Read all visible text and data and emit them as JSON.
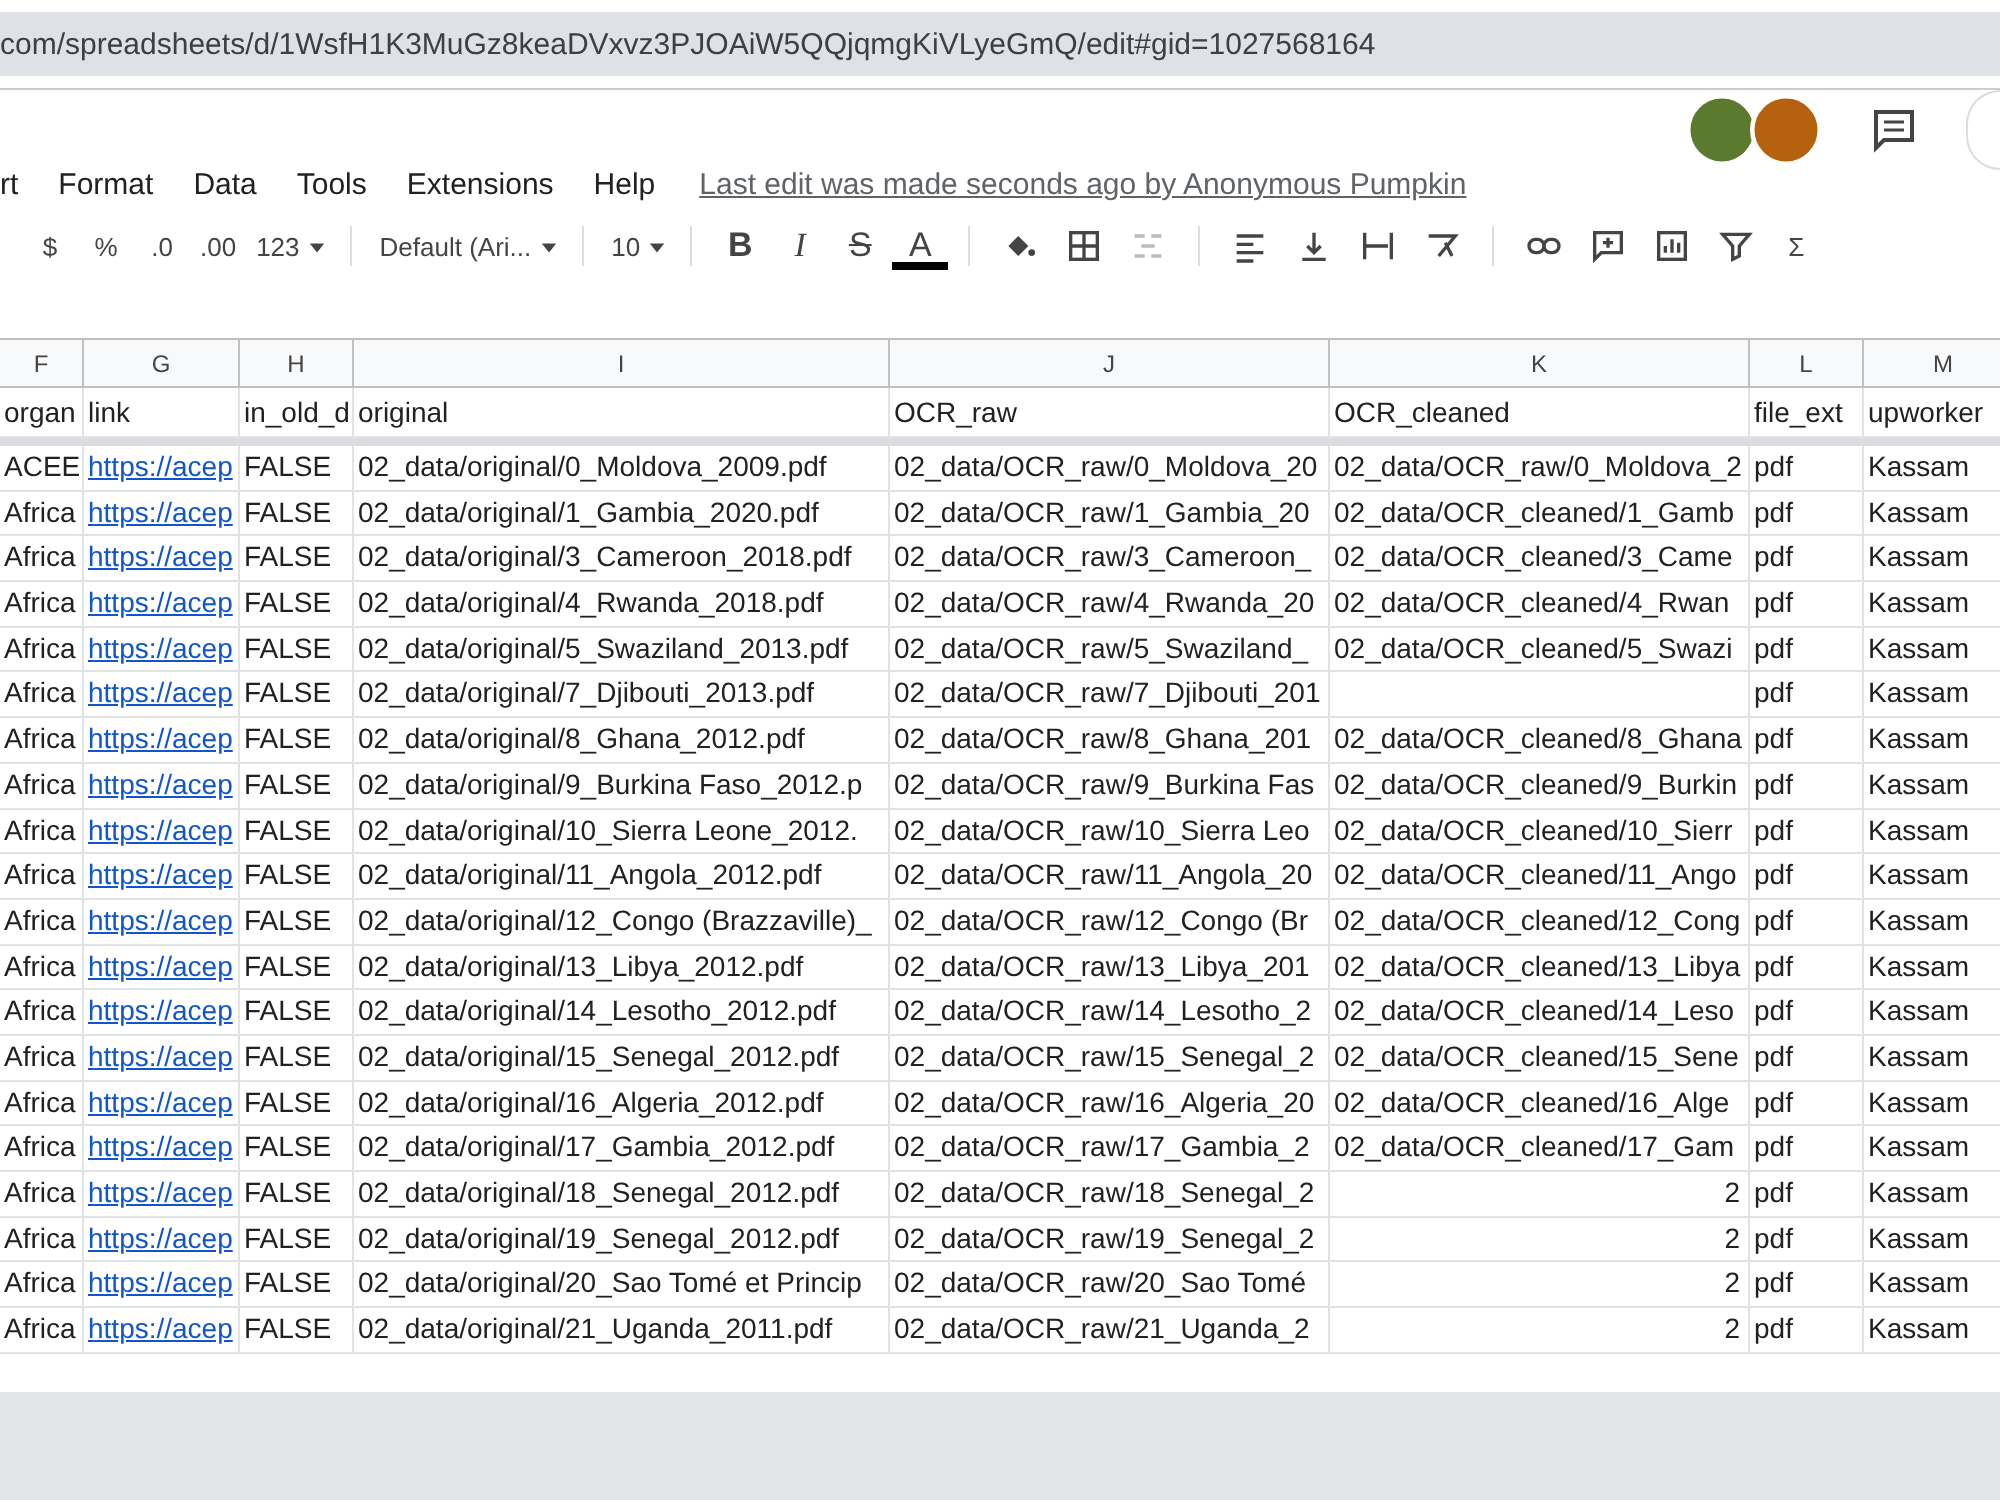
{
  "address_bar": {
    "url": "com/spreadsheets/d/1WsfH1K3MuGz8keaDVxvz3PJOAiW5QQjqmgKiVLyeGmQ/edit#gid=1027568164"
  },
  "menu": [
    "rt",
    "Format",
    "Data",
    "Tools",
    "Extensions",
    "Help"
  ],
  "last_edit": "Last edit was made seconds ago by Anonymous Pumpkin",
  "collaborators": [
    {
      "color": "#5b7a2e"
    },
    {
      "color": "#b5620f"
    }
  ],
  "toolbar": [
    {
      "kind": "text",
      "label": "$"
    },
    {
      "kind": "text",
      "label": "%"
    },
    {
      "kind": "text",
      "label": ".0"
    },
    {
      "kind": "text",
      "label": ".00"
    },
    {
      "kind": "dropdown",
      "label": "123"
    },
    {
      "kind": "sep"
    },
    {
      "kind": "dropdown",
      "label": "Default (Ari..."
    },
    {
      "kind": "sep"
    },
    {
      "kind": "dropdown",
      "label": "10"
    },
    {
      "kind": "sep"
    },
    {
      "kind": "bold",
      "label": "B"
    },
    {
      "kind": "italic",
      "label": "I"
    },
    {
      "kind": "strike",
      "label": "S"
    },
    {
      "kind": "color",
      "label": "A"
    },
    {
      "kind": "sep"
    },
    {
      "kind": "fill"
    },
    {
      "kind": "borders"
    },
    {
      "kind": "merge"
    },
    {
      "kind": "sep"
    },
    {
      "kind": "halign"
    },
    {
      "kind": "valign"
    },
    {
      "kind": "wrap"
    },
    {
      "kind": "rotate"
    },
    {
      "kind": "sep"
    },
    {
      "kind": "link"
    },
    {
      "kind": "comment"
    },
    {
      "kind": "chart"
    },
    {
      "kind": "filter"
    },
    {
      "kind": "text",
      "label": "Σ"
    }
  ],
  "columns": [
    {
      "letter": "F",
      "header": "organ"
    },
    {
      "letter": "G",
      "header": "link"
    },
    {
      "letter": "H",
      "header": "in_old_d"
    },
    {
      "letter": "I",
      "header": "original"
    },
    {
      "letter": "J",
      "header": "OCR_raw"
    },
    {
      "letter": "K",
      "header": "OCR_cleaned"
    },
    {
      "letter": "L",
      "header": "file_ext"
    },
    {
      "letter": "M",
      "header": "upworker"
    }
  ],
  "rows": [
    {
      "cells": [
        {
          "kind": "text",
          "text": "ACEE"
        },
        {
          "kind": "link",
          "text": "https://acep"
        },
        {
          "kind": "text",
          "text": "FALSE"
        },
        {
          "kind": "text",
          "text": "02_data/original/0_Moldova_2009.pdf"
        },
        {
          "kind": "text",
          "text": "02_data/OCR_raw/0_Moldova_20"
        },
        {
          "kind": "text",
          "text": "02_data/OCR_raw/0_Moldova_2"
        },
        {
          "kind": "text",
          "text": "pdf"
        },
        {
          "kind": "text",
          "text": "Kassam"
        }
      ]
    },
    {
      "cells": [
        {
          "kind": "text",
          "text": "Africa"
        },
        {
          "kind": "link",
          "text": "https://acep"
        },
        {
          "kind": "text",
          "text": "FALSE"
        },
        {
          "kind": "text",
          "text": "02_data/original/1_Gambia_2020.pdf"
        },
        {
          "kind": "text",
          "text": "02_data/OCR_raw/1_Gambia_20"
        },
        {
          "kind": "text",
          "text": "02_data/OCR_cleaned/1_Gamb"
        },
        {
          "kind": "text",
          "text": "pdf"
        },
        {
          "kind": "text",
          "text": "Kassam"
        }
      ]
    },
    {
      "cells": [
        {
          "kind": "text",
          "text": "Africa"
        },
        {
          "kind": "link",
          "text": "https://acep"
        },
        {
          "kind": "text",
          "text": "FALSE"
        },
        {
          "kind": "text",
          "text": "02_data/original/3_Cameroon_2018.pdf"
        },
        {
          "kind": "text",
          "text": "02_data/OCR_raw/3_Cameroon_"
        },
        {
          "kind": "text",
          "text": "02_data/OCR_cleaned/3_Came"
        },
        {
          "kind": "text",
          "text": "pdf"
        },
        {
          "kind": "text",
          "text": "Kassam"
        }
      ]
    },
    {
      "cells": [
        {
          "kind": "text",
          "text": "Africa"
        },
        {
          "kind": "link",
          "text": "https://acep"
        },
        {
          "kind": "text",
          "text": "FALSE"
        },
        {
          "kind": "text",
          "text": "02_data/original/4_Rwanda_2018.pdf"
        },
        {
          "kind": "text",
          "text": "02_data/OCR_raw/4_Rwanda_20"
        },
        {
          "kind": "text",
          "text": "02_data/OCR_cleaned/4_Rwan"
        },
        {
          "kind": "text",
          "text": "pdf"
        },
        {
          "kind": "text",
          "text": "Kassam"
        }
      ]
    },
    {
      "cells": [
        {
          "kind": "text",
          "text": "Africa"
        },
        {
          "kind": "link",
          "text": "https://acep"
        },
        {
          "kind": "text",
          "text": "FALSE"
        },
        {
          "kind": "text",
          "text": "02_data/original/5_Swaziland_2013.pdf"
        },
        {
          "kind": "text",
          "text": "02_data/OCR_raw/5_Swaziland_"
        },
        {
          "kind": "text",
          "text": "02_data/OCR_cleaned/5_Swazi"
        },
        {
          "kind": "text",
          "text": "pdf"
        },
        {
          "kind": "text",
          "text": "Kassam"
        }
      ]
    },
    {
      "cells": [
        {
          "kind": "text",
          "text": "Africa"
        },
        {
          "kind": "link",
          "text": "https://acep"
        },
        {
          "kind": "text",
          "text": "FALSE"
        },
        {
          "kind": "text",
          "text": "02_data/original/7_Djibouti_2013.pdf"
        },
        {
          "kind": "text",
          "text": "02_data/OCR_raw/7_Djibouti_201"
        },
        {
          "kind": "blank"
        },
        {
          "kind": "text",
          "text": "pdf"
        },
        {
          "kind": "text",
          "text": "Kassam"
        }
      ]
    },
    {
      "cells": [
        {
          "kind": "text",
          "text": "Africa"
        },
        {
          "kind": "link",
          "text": "https://acep"
        },
        {
          "kind": "text",
          "text": "FALSE"
        },
        {
          "kind": "text",
          "text": "02_data/original/8_Ghana_2012.pdf"
        },
        {
          "kind": "text",
          "text": "02_data/OCR_raw/8_Ghana_201"
        },
        {
          "kind": "text",
          "text": "02_data/OCR_cleaned/8_Ghana"
        },
        {
          "kind": "text",
          "text": "pdf"
        },
        {
          "kind": "text",
          "text": "Kassam"
        }
      ]
    },
    {
      "cells": [
        {
          "kind": "text",
          "text": "Africa"
        },
        {
          "kind": "link",
          "text": "https://acep"
        },
        {
          "kind": "text",
          "text": "FALSE"
        },
        {
          "kind": "text",
          "text": "02_data/original/9_Burkina Faso_2012.p"
        },
        {
          "kind": "text",
          "text": "02_data/OCR_raw/9_Burkina Fas"
        },
        {
          "kind": "text",
          "text": "02_data/OCR_cleaned/9_Burkin"
        },
        {
          "kind": "text",
          "text": "pdf"
        },
        {
          "kind": "text",
          "text": "Kassam"
        }
      ]
    },
    {
      "cells": [
        {
          "kind": "text",
          "text": "Africa"
        },
        {
          "kind": "link",
          "text": "https://acep"
        },
        {
          "kind": "text",
          "text": "FALSE"
        },
        {
          "kind": "text",
          "text": "02_data/original/10_Sierra Leone_2012."
        },
        {
          "kind": "text",
          "text": "02_data/OCR_raw/10_Sierra Leo"
        },
        {
          "kind": "text",
          "text": "02_data/OCR_cleaned/10_Sierr"
        },
        {
          "kind": "text",
          "text": "pdf"
        },
        {
          "kind": "text",
          "text": "Kassam"
        }
      ]
    },
    {
      "cells": [
        {
          "kind": "text",
          "text": "Africa"
        },
        {
          "kind": "link",
          "text": "https://acep"
        },
        {
          "kind": "text",
          "text": "FALSE"
        },
        {
          "kind": "text",
          "text": "02_data/original/11_Angola_2012.pdf"
        },
        {
          "kind": "text",
          "text": "02_data/OCR_raw/11_Angola_20"
        },
        {
          "kind": "text",
          "text": "02_data/OCR_cleaned/11_Ango"
        },
        {
          "kind": "text",
          "text": "pdf"
        },
        {
          "kind": "text",
          "text": "Kassam"
        }
      ]
    },
    {
      "cells": [
        {
          "kind": "text",
          "text": "Africa"
        },
        {
          "kind": "link",
          "text": "https://acep"
        },
        {
          "kind": "text",
          "text": "FALSE"
        },
        {
          "kind": "text",
          "text": "02_data/original/12_Congo (Brazzaville)_"
        },
        {
          "kind": "text",
          "text": "02_data/OCR_raw/12_Congo (Br"
        },
        {
          "kind": "text",
          "text": "02_data/OCR_cleaned/12_Cong"
        },
        {
          "kind": "text",
          "text": "pdf"
        },
        {
          "kind": "text",
          "text": "Kassam"
        }
      ]
    },
    {
      "cells": [
        {
          "kind": "text",
          "text": "Africa"
        },
        {
          "kind": "link",
          "text": "https://acep"
        },
        {
          "kind": "text",
          "text": "FALSE"
        },
        {
          "kind": "text",
          "text": "02_data/original/13_Libya_2012.pdf"
        },
        {
          "kind": "text",
          "text": "02_data/OCR_raw/13_Libya_201"
        },
        {
          "kind": "text",
          "text": "02_data/OCR_cleaned/13_Libya"
        },
        {
          "kind": "text",
          "text": "pdf"
        },
        {
          "kind": "text",
          "text": "Kassam"
        }
      ]
    },
    {
      "cells": [
        {
          "kind": "text",
          "text": "Africa"
        },
        {
          "kind": "link",
          "text": "https://acep"
        },
        {
          "kind": "text",
          "text": "FALSE"
        },
        {
          "kind": "text",
          "text": "02_data/original/14_Lesotho_2012.pdf"
        },
        {
          "kind": "text",
          "text": "02_data/OCR_raw/14_Lesotho_2"
        },
        {
          "kind": "text",
          "text": "02_data/OCR_cleaned/14_Leso"
        },
        {
          "kind": "text",
          "text": "pdf"
        },
        {
          "kind": "text",
          "text": "Kassam"
        }
      ]
    },
    {
      "cells": [
        {
          "kind": "text",
          "text": "Africa"
        },
        {
          "kind": "link",
          "text": "https://acep"
        },
        {
          "kind": "text",
          "text": "FALSE"
        },
        {
          "kind": "text",
          "text": "02_data/original/15_Senegal_2012.pdf"
        },
        {
          "kind": "text",
          "text": "02_data/OCR_raw/15_Senegal_2"
        },
        {
          "kind": "text",
          "text": "02_data/OCR_cleaned/15_Sene"
        },
        {
          "kind": "text",
          "text": "pdf"
        },
        {
          "kind": "text",
          "text": "Kassam"
        }
      ]
    },
    {
      "cells": [
        {
          "kind": "text",
          "text": "Africa"
        },
        {
          "kind": "link",
          "text": "https://acep"
        },
        {
          "kind": "text",
          "text": "FALSE"
        },
        {
          "kind": "text",
          "text": "02_data/original/16_Algeria_2012.pdf"
        },
        {
          "kind": "text",
          "text": "02_data/OCR_raw/16_Algeria_20"
        },
        {
          "kind": "text",
          "text": "02_data/OCR_cleaned/16_Alge"
        },
        {
          "kind": "text",
          "text": "pdf"
        },
        {
          "kind": "text",
          "text": "Kassam"
        }
      ]
    },
    {
      "cells": [
        {
          "kind": "text",
          "text": "Africa"
        },
        {
          "kind": "link",
          "text": "https://acep"
        },
        {
          "kind": "text",
          "text": "FALSE"
        },
        {
          "kind": "text",
          "text": "02_data/original/17_Gambia_2012.pdf"
        },
        {
          "kind": "text",
          "text": "02_data/OCR_raw/17_Gambia_2"
        },
        {
          "kind": "text",
          "text": "02_data/OCR_cleaned/17_Gam"
        },
        {
          "kind": "text",
          "text": "pdf"
        },
        {
          "kind": "text",
          "text": "Kassam"
        }
      ]
    },
    {
      "cells": [
        {
          "kind": "text",
          "text": "Africa"
        },
        {
          "kind": "link",
          "text": "https://acep"
        },
        {
          "kind": "text",
          "text": "FALSE"
        },
        {
          "kind": "text",
          "text": "02_data/original/18_Senegal_2012.pdf"
        },
        {
          "kind": "text",
          "text": "02_data/OCR_raw/18_Senegal_2"
        },
        {
          "kind": "number",
          "text": "2"
        },
        {
          "kind": "text",
          "text": "pdf"
        },
        {
          "kind": "text",
          "text": "Kassam"
        }
      ]
    },
    {
      "cells": [
        {
          "kind": "text",
          "text": "Africa"
        },
        {
          "kind": "link",
          "text": "https://acep"
        },
        {
          "kind": "text",
          "text": "FALSE"
        },
        {
          "kind": "text",
          "text": "02_data/original/19_Senegal_2012.pdf"
        },
        {
          "kind": "text",
          "text": "02_data/OCR_raw/19_Senegal_2"
        },
        {
          "kind": "number",
          "text": "2"
        },
        {
          "kind": "text",
          "text": "pdf"
        },
        {
          "kind": "text",
          "text": "Kassam"
        }
      ]
    },
    {
      "cells": [
        {
          "kind": "text",
          "text": "Africa"
        },
        {
          "kind": "link",
          "text": "https://acep"
        },
        {
          "kind": "text",
          "text": "FALSE"
        },
        {
          "kind": "text",
          "text": "02_data/original/20_Sao Tomé et Princip"
        },
        {
          "kind": "text",
          "text": "02_data/OCR_raw/20_Sao Tomé"
        },
        {
          "kind": "number",
          "text": "2"
        },
        {
          "kind": "text",
          "text": "pdf"
        },
        {
          "kind": "text",
          "text": "Kassam"
        }
      ]
    },
    {
      "cells": [
        {
          "kind": "text",
          "text": "Africa"
        },
        {
          "kind": "link",
          "text": "https://acep"
        },
        {
          "kind": "text",
          "text": "FALSE"
        },
        {
          "kind": "text",
          "text": "02_data/original/21_Uganda_2011.pdf"
        },
        {
          "kind": "text",
          "text": "02_data/OCR_raw/21_Uganda_2"
        },
        {
          "kind": "number",
          "text": "2"
        },
        {
          "kind": "text",
          "text": "pdf"
        },
        {
          "kind": "text",
          "text": "Kassam"
        }
      ]
    }
  ]
}
